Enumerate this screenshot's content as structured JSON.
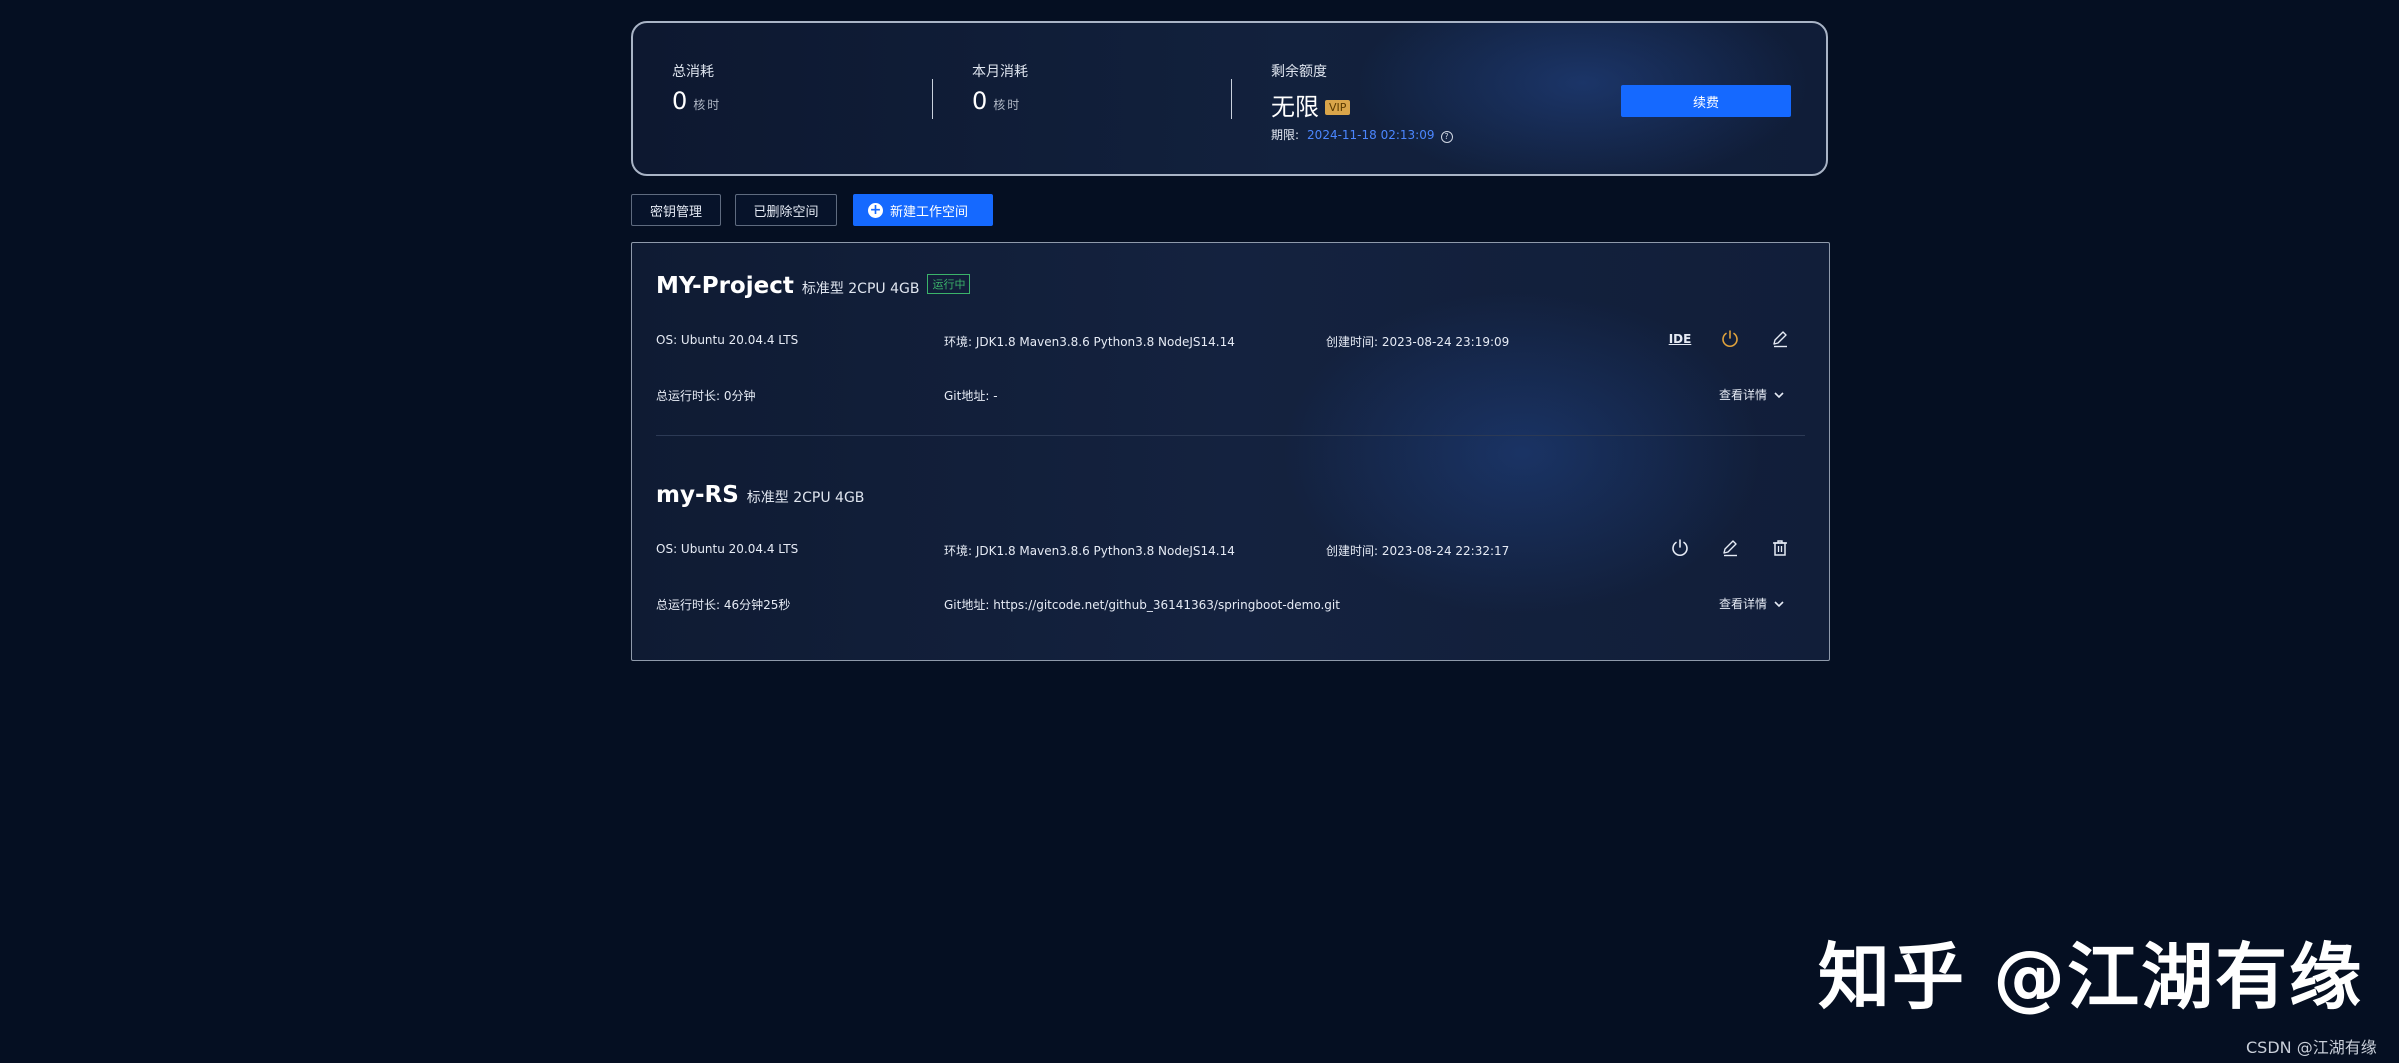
{
  "summary": {
    "total_label": "总消耗",
    "total_value": "0",
    "total_unit": "核时",
    "month_label": "本月消耗",
    "month_value": "0",
    "month_unit": "核时",
    "remaining_label": "剩余额度",
    "remaining_value": "无限",
    "vip_badge": "VIP",
    "expire_label": "期限:",
    "expire_date": "2024-11-18 02:13:09",
    "renew_label": "续费"
  },
  "toolbar": {
    "key_manage": "密钥管理",
    "deleted_spaces": "已删除空间",
    "new_workspace": "新建工作空间"
  },
  "workspaces": [
    {
      "name": "MY-Project",
      "spec": "标准型 2CPU 4GB",
      "status": "运行中",
      "os": "OS: Ubuntu 20.04.4 LTS",
      "env": "环境: JDK1.8 Maven3.8.6 Python3.8 NodeJS14.14",
      "created": "创建时间: 2023-08-24 23:19:09",
      "runtime": "总运行时长: 0分钟",
      "git": "Git地址: -",
      "ide_label": "IDE",
      "details": "查看详情"
    },
    {
      "name": "my-RS",
      "spec": "标准型 2CPU 4GB",
      "os": "OS: Ubuntu 20.04.4 LTS",
      "env": "环境: JDK1.8 Maven3.8.6 Python3.8 NodeJS14.14",
      "created": "创建时间: 2023-08-24 22:32:17",
      "runtime": "总运行时长: 46分钟25秒",
      "git": "Git地址: https://gitcode.net/github_36141363/springboot-demo.git",
      "details": "查看详情"
    }
  ],
  "watermark": {
    "zhihu": "知乎 @江湖有缘",
    "csdn": "CSDN @江湖有缘"
  },
  "colors": {
    "accent": "#1569ff",
    "running": "#3bb36a",
    "power_active": "#e0a23c",
    "vip": "#d9a54a"
  }
}
